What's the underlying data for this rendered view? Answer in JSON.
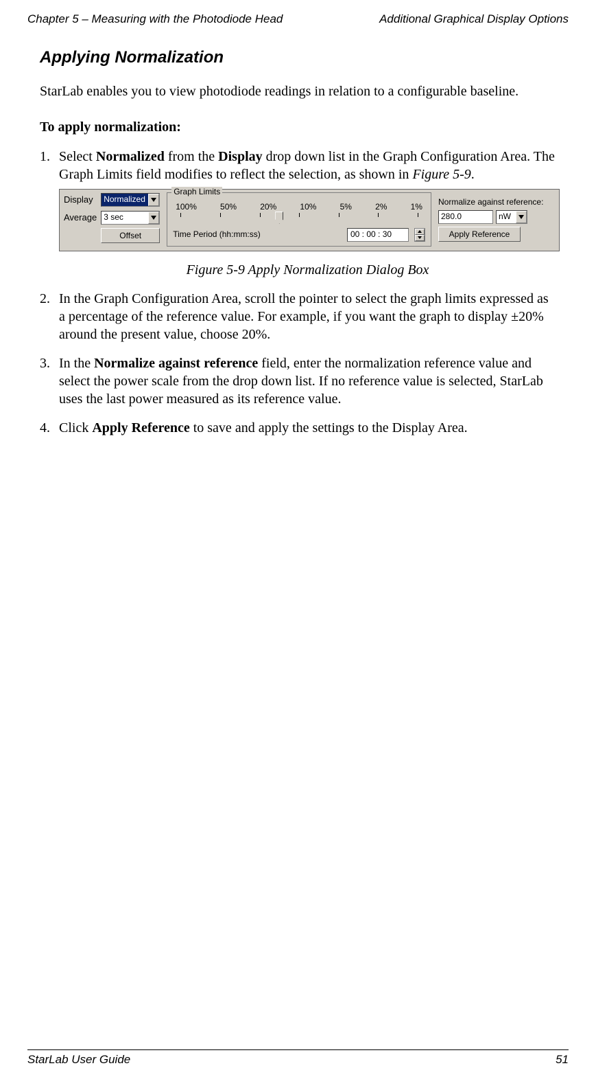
{
  "header": {
    "left": "Chapter 5 – Measuring with the Photodiode Head",
    "right": "Additional Graphical Display Options"
  },
  "section": {
    "title": "Applying Normalization",
    "intro": "StarLab enables you to view photodiode readings in relation to a configurable baseline.",
    "lead": "To apply normalization:",
    "step1_a": "Select ",
    "step1_b": "Normalized",
    "step1_c": " from the ",
    "step1_d": "Display",
    "step1_e": " drop down list in the Graph Configuration Area. The Graph Limits field modifies to reflect the selection, as shown in ",
    "step1_f": "Figure 5-9",
    "step1_g": ".",
    "figure_caption": "Figure 5-9 Apply Normalization Dialog Box",
    "step2": "In the Graph Configuration Area, scroll the pointer to select the graph limits expressed as a percentage of the reference value. For example, if you want the graph to display ±20% around the present value, choose 20%.",
    "step3_a": "In the ",
    "step3_b": "Normalize against reference",
    "step3_c": " field, enter the normalization reference value and select the power scale from the drop down list. If no reference value is selected, StarLab uses the last power measured as its reference value.",
    "step4_a": "Click ",
    "step4_b": "Apply Reference",
    "step4_c": " to save and apply the settings to the Display Area."
  },
  "dialog": {
    "label_display": "Display",
    "label_average": "Average",
    "display_value": "Normalized",
    "average_value": "3 sec",
    "offset_btn": "Offset",
    "group_title": "Graph Limits",
    "scale": [
      "100%",
      "50%",
      "20%",
      "10%",
      "5%",
      "2%",
      "1%"
    ],
    "time_label": "Time Period (hh:mm:ss)",
    "time_value": "00 : 00 : 30",
    "ref_label": "Normalize against reference:",
    "ref_value": "280.0",
    "ref_unit": "nW",
    "apply_btn": "Apply Reference"
  },
  "footer": {
    "left": "StarLab User Guide",
    "right": "51"
  }
}
